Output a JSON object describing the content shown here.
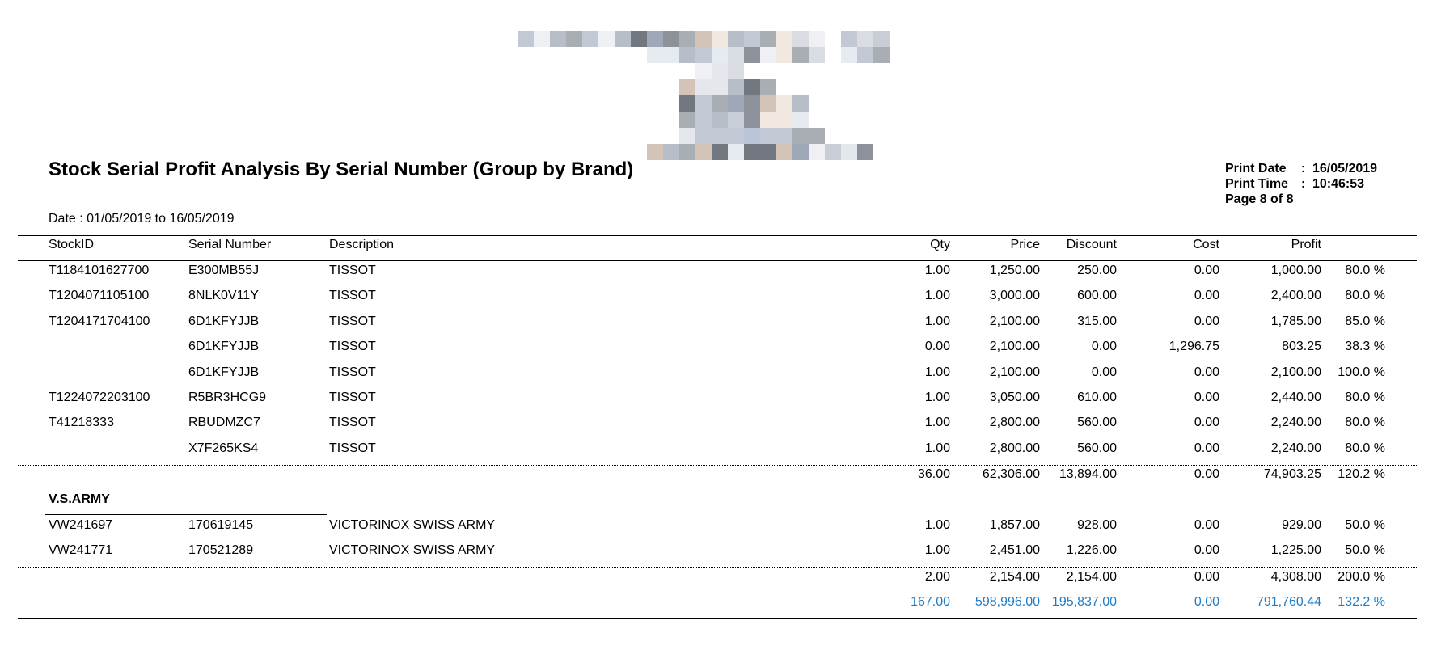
{
  "report": {
    "title": "Stock Serial Profit Analysis By Serial Number (Group by Brand)",
    "print_date_label": "Print Date",
    "print_date": "16/05/2019",
    "print_time_label": "Print Time",
    "print_time": "10:46:53",
    "page": "Page 8 of 8",
    "date_range": "Date : 01/05/2019 to 16/05/2019"
  },
  "columns": {
    "stockid": "StockID",
    "serial": "Serial Number",
    "description": "Description",
    "qty": "Qty",
    "price": "Price",
    "discount": "Discount",
    "cost": "Cost",
    "profit": "Profit"
  },
  "group1": {
    "rows": [
      {
        "stockid": "T1184101627700",
        "serial": "E300MB55J",
        "desc": "TISSOT",
        "qty": "1.00",
        "price": "1,250.00",
        "discount": "250.00",
        "cost": "0.00",
        "profit": "1,000.00",
        "pct": "80.0 %"
      },
      {
        "stockid": "T1204071105100",
        "serial": "8NLK0V11Y",
        "desc": "TISSOT",
        "qty": "1.00",
        "price": "3,000.00",
        "discount": "600.00",
        "cost": "0.00",
        "profit": "2,400.00",
        "pct": "80.0 %"
      },
      {
        "stockid": "T1204171704100",
        "serial": "6D1KFYJJB",
        "desc": "TISSOT",
        "qty": "1.00",
        "price": "2,100.00",
        "discount": "315.00",
        "cost": "0.00",
        "profit": "1,785.00",
        "pct": "85.0 %"
      },
      {
        "stockid": "",
        "serial": "6D1KFYJJB",
        "desc": "TISSOT",
        "qty": "0.00",
        "price": "2,100.00",
        "discount": "0.00",
        "cost": "1,296.75",
        "profit": "803.25",
        "pct": "38.3 %"
      },
      {
        "stockid": "",
        "serial": "6D1KFYJJB",
        "desc": "TISSOT",
        "qty": "1.00",
        "price": "2,100.00",
        "discount": "0.00",
        "cost": "0.00",
        "profit": "2,100.00",
        "pct": "100.0 %"
      },
      {
        "stockid": "T1224072203100",
        "serial": "R5BR3HCG9",
        "desc": "TISSOT",
        "qty": "1.00",
        "price": "3,050.00",
        "discount": "610.00",
        "cost": "0.00",
        "profit": "2,440.00",
        "pct": "80.0 %"
      },
      {
        "stockid": "T41218333",
        "serial": "RBUDMZC7",
        "desc": "TISSOT",
        "qty": "1.00",
        "price": "2,800.00",
        "discount": "560.00",
        "cost": "0.00",
        "profit": "2,240.00",
        "pct": "80.0 %"
      },
      {
        "stockid": "",
        "serial": "X7F265KS4",
        "desc": "TISSOT",
        "qty": "1.00",
        "price": "2,800.00",
        "discount": "560.00",
        "cost": "0.00",
        "profit": "2,240.00",
        "pct": "80.0 %"
      }
    ],
    "subtotal": {
      "qty": "36.00",
      "price": "62,306.00",
      "discount": "13,894.00",
      "cost": "0.00",
      "profit": "74,903.25",
      "pct": "120.2 %"
    }
  },
  "group2": {
    "brand": "V.S.ARMY",
    "rows": [
      {
        "stockid": "VW241697",
        "serial": "170619145",
        "desc": "VICTORINOX SWISS ARMY",
        "qty": "1.00",
        "price": "1,857.00",
        "discount": "928.00",
        "cost": "0.00",
        "profit": "929.00",
        "pct": "50.0 %"
      },
      {
        "stockid": "VW241771",
        "serial": "170521289",
        "desc": "VICTORINOX SWISS ARMY",
        "qty": "1.00",
        "price": "2,451.00",
        "discount": "1,226.00",
        "cost": "0.00",
        "profit": "1,225.00",
        "pct": "50.0 %"
      }
    ],
    "subtotal": {
      "qty": "2.00",
      "price": "2,154.00",
      "discount": "2,154.00",
      "cost": "0.00",
      "profit": "4,308.00",
      "pct": "200.0 %"
    }
  },
  "grand_total": {
    "qty": "167.00",
    "price": "598,996.00",
    "discount": "195,837.00",
    "cost": "0.00",
    "profit": "791,760.44",
    "pct": "132.2 %"
  },
  "colors": {
    "total_blue": "#1e7cc8"
  }
}
